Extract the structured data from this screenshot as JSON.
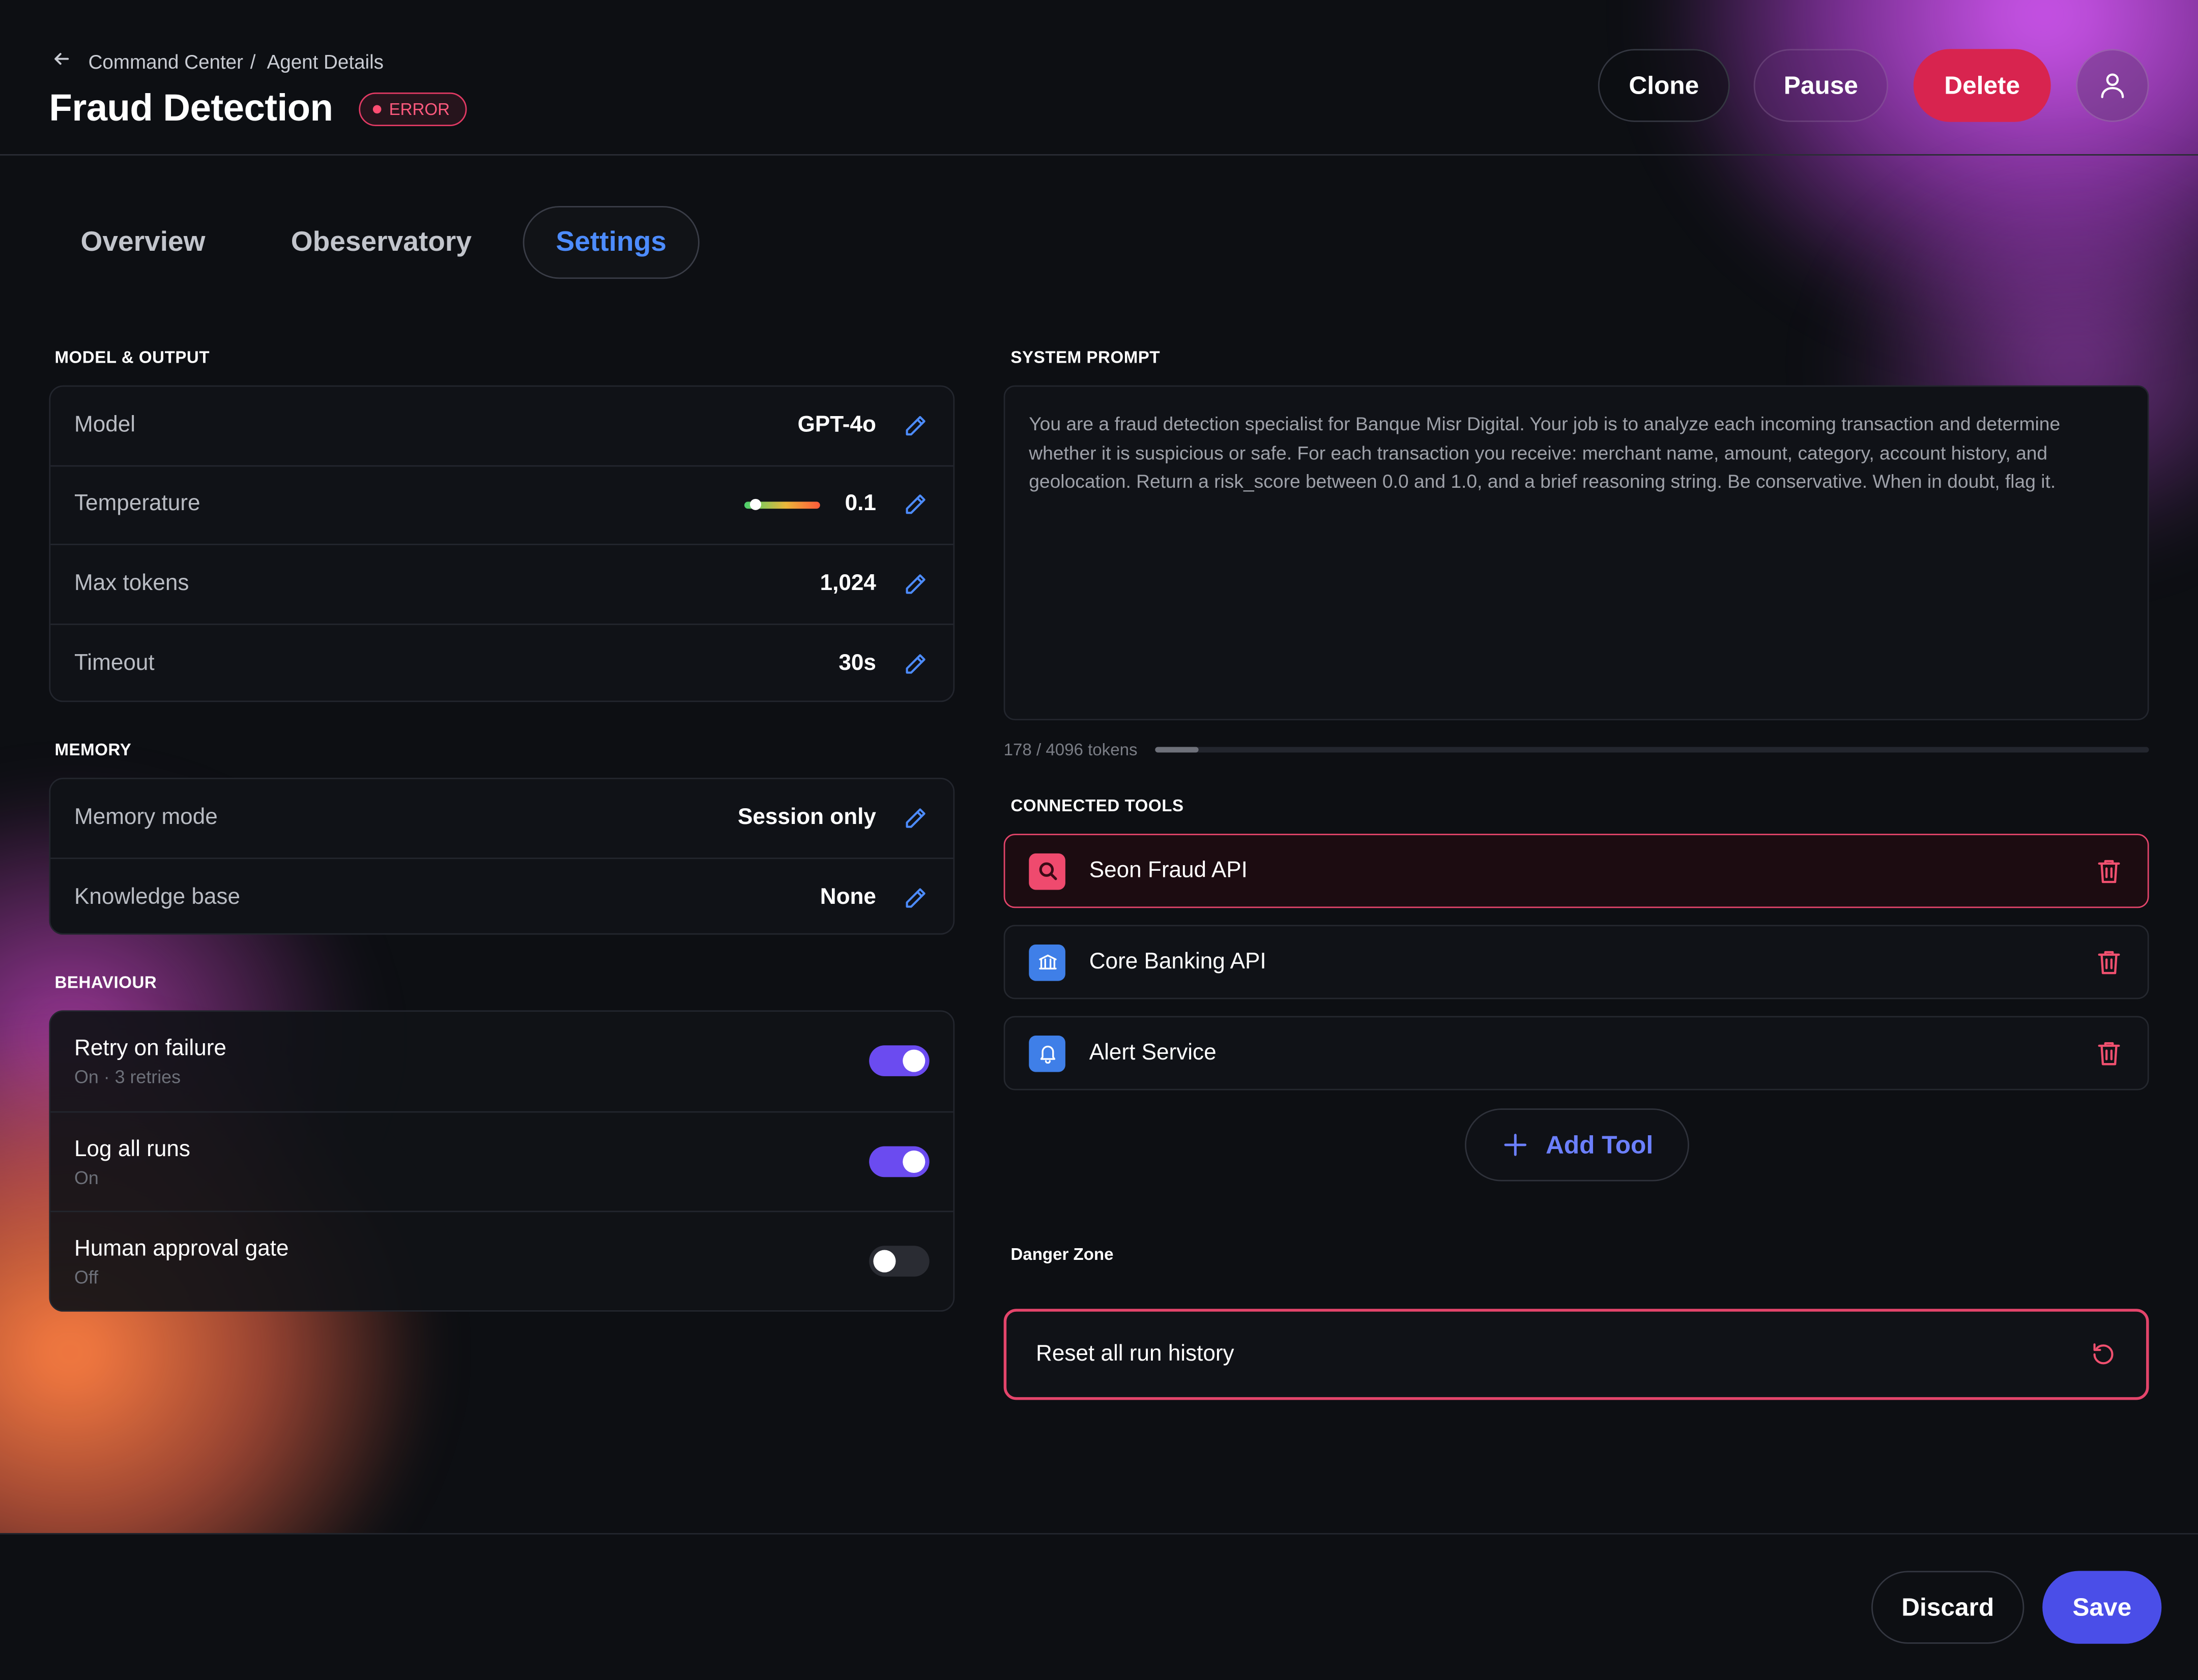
{
  "breadcrumb": {
    "parent": "Command Center",
    "separator": "/",
    "current": "Agent Details"
  },
  "page": {
    "title": "Fraud Detection",
    "status_badge": "ERROR"
  },
  "header_actions": {
    "clone": "Clone",
    "pause": "Pause",
    "delete": "Delete"
  },
  "tabs": [
    {
      "label": "Overview"
    },
    {
      "label": "Obeservatory"
    },
    {
      "label": "Settings",
      "active": true
    }
  ],
  "model_output": {
    "heading": "MODEL & OUTPUT",
    "rows": [
      {
        "label": "Model",
        "value": "GPT-4o"
      },
      {
        "label": "Temperature",
        "value": "0.1",
        "level": 0.1
      },
      {
        "label": "Max tokens",
        "value": "1,024"
      },
      {
        "label": "Timeout",
        "value": "30s"
      }
    ]
  },
  "memory": {
    "heading": "MEMORY",
    "rows": [
      {
        "label": "Memory mode",
        "value": "Session only"
      },
      {
        "label": "Knowledge base",
        "value": "None"
      }
    ]
  },
  "behaviour": {
    "heading": "BEHAVIOUR",
    "rows": [
      {
        "title": "Retry on failure",
        "subtitle": "On · 3 retries",
        "enabled": true
      },
      {
        "title": "Log all runs",
        "subtitle": "On",
        "enabled": true
      },
      {
        "title": "Human approval gate",
        "subtitle": "Off",
        "enabled": false
      }
    ]
  },
  "system_prompt": {
    "heading": "SYSTEM PROMPT",
    "text": "You are a fraud detection specialist for Banque Misr Digital. Your job is to analyze each incoming transaction and determine whether it is suspicious or safe. For each transaction you receive: merchant name, amount, category, account history, and geolocation. Return a risk_score between 0.0 and 1.0, and a brief reasoning string. Be conservative. When in doubt, flag it.",
    "token_count": "178 / 4096 tokens",
    "token_used": 178,
    "token_max": 4096
  },
  "connected_tools": {
    "heading": "CONNECTED TOOLS",
    "items": [
      {
        "name": "Seon Fraud API",
        "icon": "search-icon",
        "icon_color": "#ef4a6e",
        "error": true
      },
      {
        "name": "Core Banking API",
        "icon": "bank-icon",
        "icon_color": "#3f7fe8",
        "error": false
      },
      {
        "name": "Alert Service",
        "icon": "bell-icon",
        "icon_color": "#3f7fe8",
        "error": false
      }
    ],
    "add_label": "Add Tool"
  },
  "danger_zone": {
    "heading": "Danger Zone",
    "action": "Reset all run history"
  },
  "footer": {
    "discard": "Discard",
    "save": "Save"
  },
  "colors": {
    "accent": "#4d8cff",
    "danger": "#e4456b",
    "primary": "#4a4ee8",
    "toggle_on": "#6b4bf0"
  }
}
